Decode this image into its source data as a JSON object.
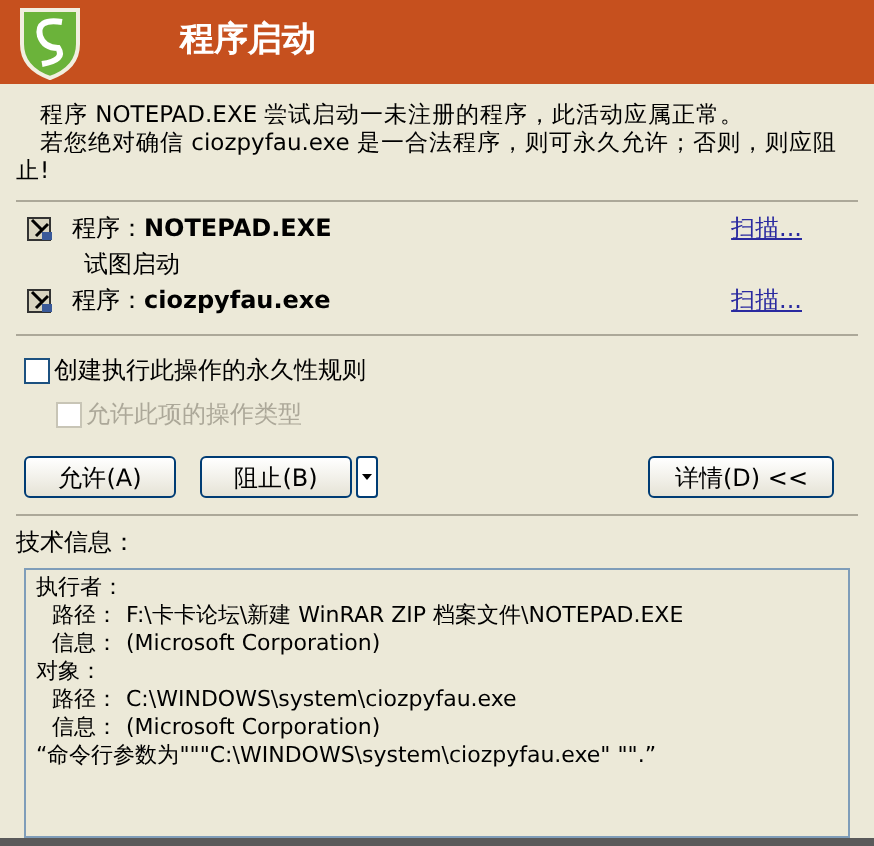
{
  "header": {
    "title": "程序启动"
  },
  "intro": [
    "程序 NOTEPAD.EXE 尝试启动一未注册的程序，此活动应属正常。",
    "若您绝对确信 ciozpyfau.exe 是一合法程序，则可永久允许；否则，则应阻止!"
  ],
  "programs": [
    {
      "label": "程序：",
      "name": "NOTEPAD.EXE",
      "link": "扫描..."
    },
    {
      "label": "程序：",
      "name": "ciozpyfau.exe",
      "link": "扫描..."
    }
  ],
  "action": "试图启动",
  "options": [
    {
      "label": "创建执行此操作的永久性规则",
      "checked": false,
      "disabled": false
    },
    {
      "label": "允许此项的操作类型",
      "checked": false,
      "disabled": true
    }
  ],
  "buttons": {
    "allow": "允许(A)",
    "block": "阻止(B)",
    "details": "详情(D) <<"
  },
  "tech_info": {
    "title": "技术信息：",
    "sections": [
      {
        "heading": "执行者：",
        "fields": [
          {
            "label": "路径：",
            "value": "F:\\卡卡论坛\\新建 WinRAR ZIP 档案文件\\NOTEPAD.EXE"
          },
          {
            "label": "信息：",
            "value": "(Microsoft Corporation)"
          }
        ]
      },
      {
        "heading": "对象：",
        "fields": [
          {
            "label": "路径：",
            "value": "C:\\WINDOWS\\system\\ciozpyfau.exe"
          },
          {
            "label": "信息：",
            "value": "(Microsoft Corporation)"
          }
        ]
      }
    ],
    "command": "“命令行参数为\"\"\"C:\\WINDOWS\\system\\ciozpyfau.exe\" \"\".”"
  }
}
